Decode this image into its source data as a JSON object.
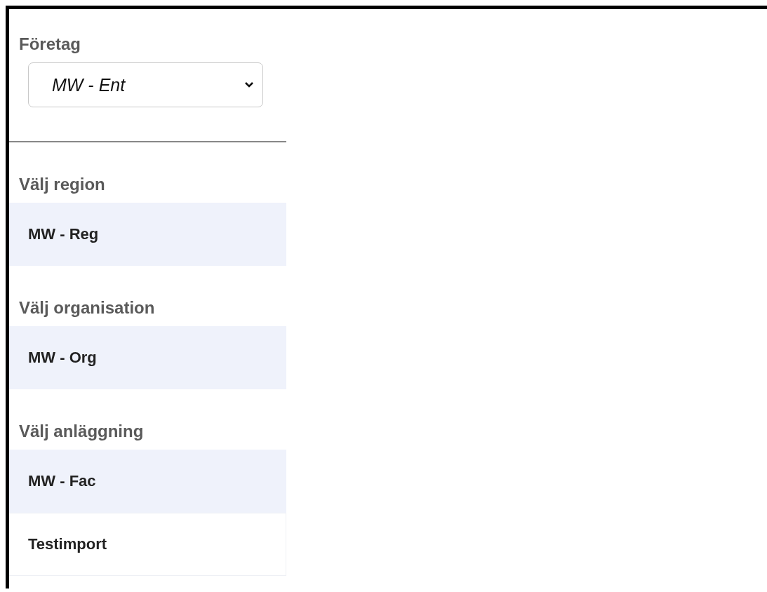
{
  "company": {
    "label": "Företag",
    "value": "MW - Ent"
  },
  "sections": [
    {
      "label": "Välj region",
      "items": [
        {
          "name": "MW - Reg",
          "selected": true
        }
      ]
    },
    {
      "label": "Välj organisation",
      "items": [
        {
          "name": "MW - Org",
          "selected": true
        }
      ]
    },
    {
      "label": "Välj anläggning",
      "items": [
        {
          "name": "MW - Fac",
          "selected": true
        },
        {
          "name": "Testimport",
          "selected": false
        }
      ]
    }
  ]
}
